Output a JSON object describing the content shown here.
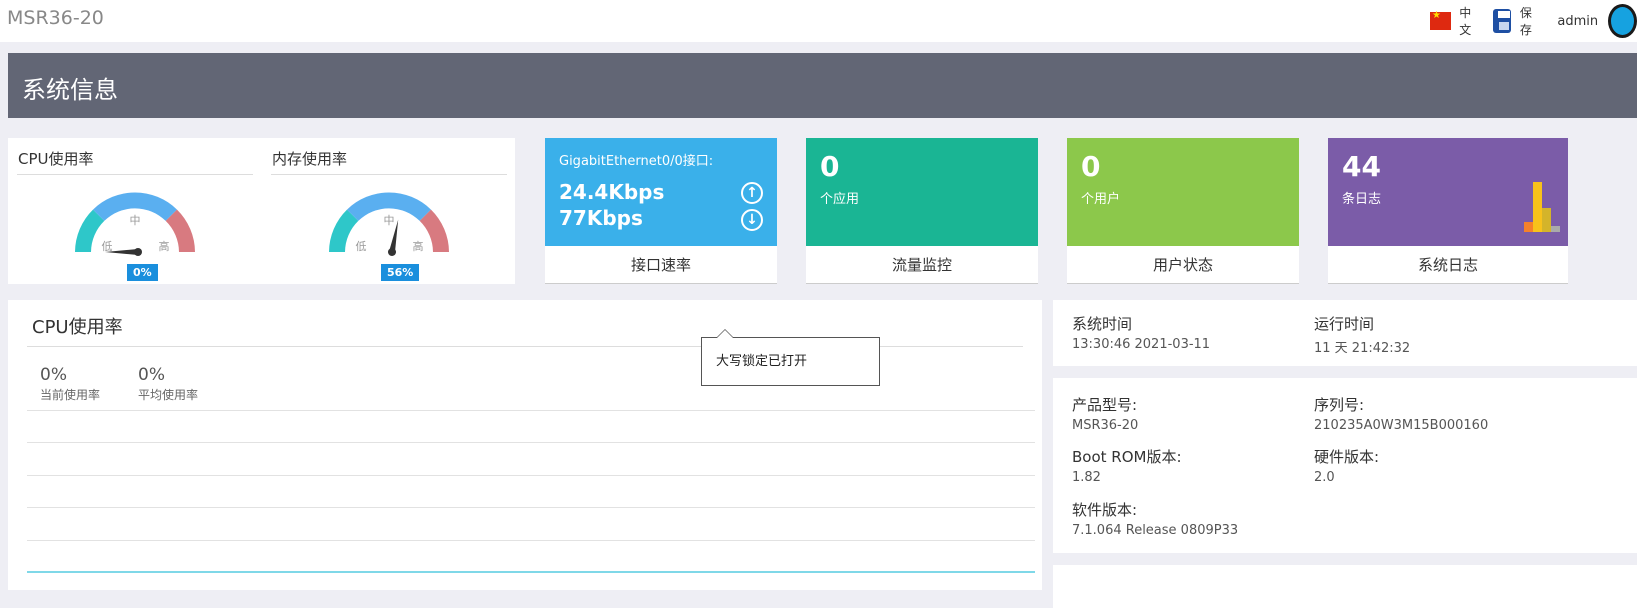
{
  "header": {
    "brand": "MSR36-20",
    "language": "中文",
    "save_label": "保存",
    "user": "admin"
  },
  "banner": {
    "title": "系统信息"
  },
  "gauges": [
    {
      "title": "CPU使用率",
      "value_text": "0%",
      "value": 0,
      "mid_label": "中",
      "low_label": "低",
      "high_label": "高"
    },
    {
      "title": "内存使用率",
      "value_text": "56%",
      "value": 56,
      "mid_label": "中",
      "low_label": "低",
      "high_label": "高"
    }
  ],
  "tiles": {
    "interface": {
      "name": "GigabitEthernet0/0接口:",
      "up_rate": "24.4Kbps",
      "down_rate": "77Kbps",
      "footer": "接口速率",
      "color": "#3ab0ea"
    },
    "traffic": {
      "count": "0",
      "unit": "个应用",
      "footer": "流量监控",
      "color": "#1ab594"
    },
    "users": {
      "count": "0",
      "unit": "个用户",
      "footer": "用户状态",
      "color": "#8cc84b"
    },
    "logs": {
      "count": "44",
      "unit": "条日志",
      "footer": "系统日志",
      "color": "#7b5ca8"
    }
  },
  "cpu_panel": {
    "title": "CPU使用率",
    "current_value": "0%",
    "current_label": "当前使用率",
    "average_value": "0%",
    "average_label": "平均使用率"
  },
  "tooltip": {
    "text": "大写锁定已打开"
  },
  "system_info": {
    "time_label": "系统时间",
    "time_value": "13:30:46  2021-03-11",
    "uptime_label": "运行时间",
    "uptime_value": "11 天  21:42:32",
    "model_label": "产品型号:",
    "model_value": "MSR36-20",
    "serial_label": "序列号:",
    "serial_value": "210235A0W3M15B000160",
    "bootrom_label": "Boot ROM版本:",
    "bootrom_value": "1.82",
    "hardware_label": "硬件版本:",
    "hardware_value": "2.0",
    "software_label": "软件版本:",
    "software_value": "7.1.064 Release 0809P33"
  }
}
